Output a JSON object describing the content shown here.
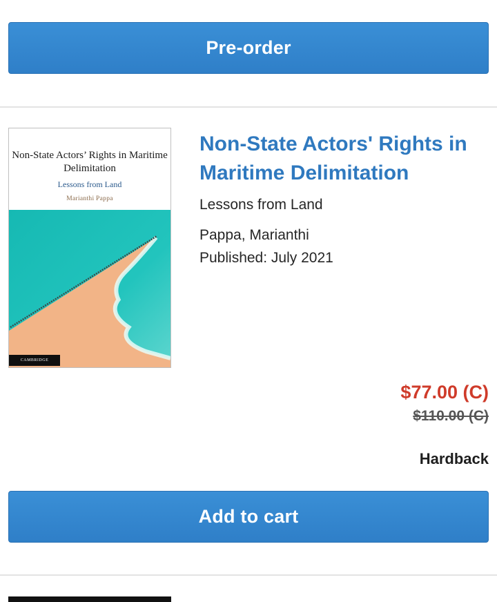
{
  "top_action": {
    "label": "Pre-order"
  },
  "product": {
    "title": "Non-State Actors' Rights in Maritime Delimitation",
    "subtitle": "Lessons from Land",
    "author": "Pappa, Marianthi",
    "published": "Published: July 2021",
    "price_now": "$77.00 (C)",
    "price_was": "$110.00 (C)",
    "format": "Hardback",
    "cover": {
      "title": "Non-State Actors’ Rights in Maritime Delimitation",
      "subtitle": "Lessons from Land",
      "author": "Marianthi Pappa",
      "publisher": "CAMBRIDGE"
    },
    "add_to_cart_label": "Add to cart"
  },
  "colors": {
    "button": "#2f7fc8",
    "title": "#2f79bf",
    "sale_price": "#cf3b2a"
  }
}
